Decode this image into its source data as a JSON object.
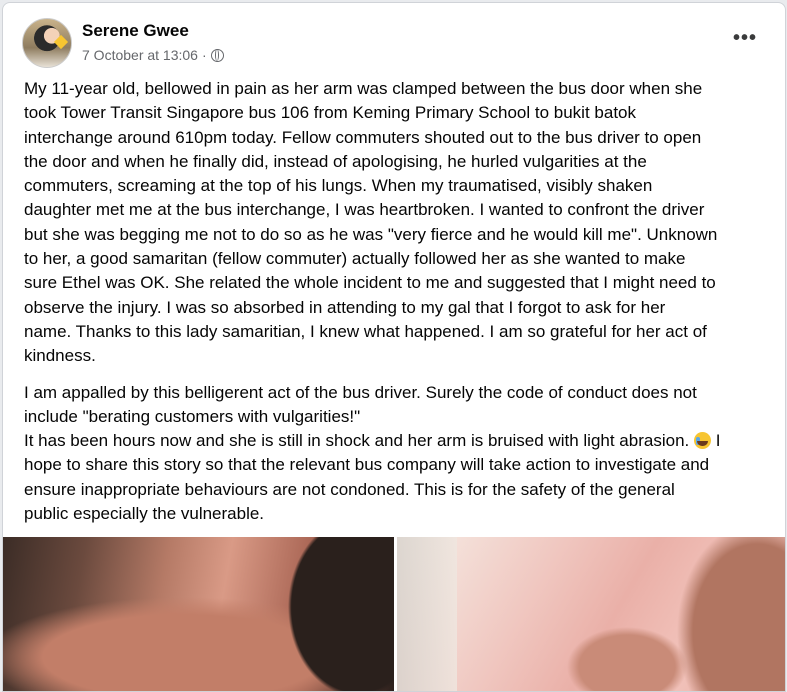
{
  "post": {
    "author": "Serene Gwee",
    "timestamp": "7 October at 13:06",
    "separator": "·",
    "privacy_icon": "globe-icon",
    "more_label": "•••",
    "paragraph1_lines": [
      "My 11-year old, bellowed in pain as her arm was clamped between the bus door when she",
      "took Tower Transit Singapore bus 106 from Keming Primary School to bukit batok",
      "interchange around 610pm today. Fellow commuters shouted out to the bus driver to open",
      "the door and when he finally did, instead of apologising, he hurled vulgarities at the",
      "commuters, screaming at the top of his lungs. When my traumatised, visibly shaken",
      "daughter met me at the bus interchange, I was heartbroken. I wanted to confront the driver",
      "but she was begging me not to do so as he was \"very fierce and he would kill me\". Unknown",
      "to her, a good samaritan (fellow commuter) actually followed her as she wanted to make",
      "sure Ethel was OK. She related the whole incident to me and suggested that I might need to",
      "observe the injury. I was so absorbed in attending to my gal that I forgot to ask for her",
      "name. Thanks to this lady samaritian, I knew what happened. I am so grateful for her act of",
      "kindness."
    ],
    "paragraph2_lines": [
      "I am appalled by this belligerent act of the bus driver. Surely the code of conduct does not",
      "include \"berating customers with vulgarities!\"",
      "It has been hours now and she is still in shock and her arm is bruised with light abrasion.",
      "I",
      "hope to share this story so that the relevant bus company will take action to investigate and",
      "ensure inappropriate behaviours are not condoned. This is for the safety of the general",
      "public especially the vulnerable."
    ],
    "emoji_icon": "crying-face-icon"
  }
}
